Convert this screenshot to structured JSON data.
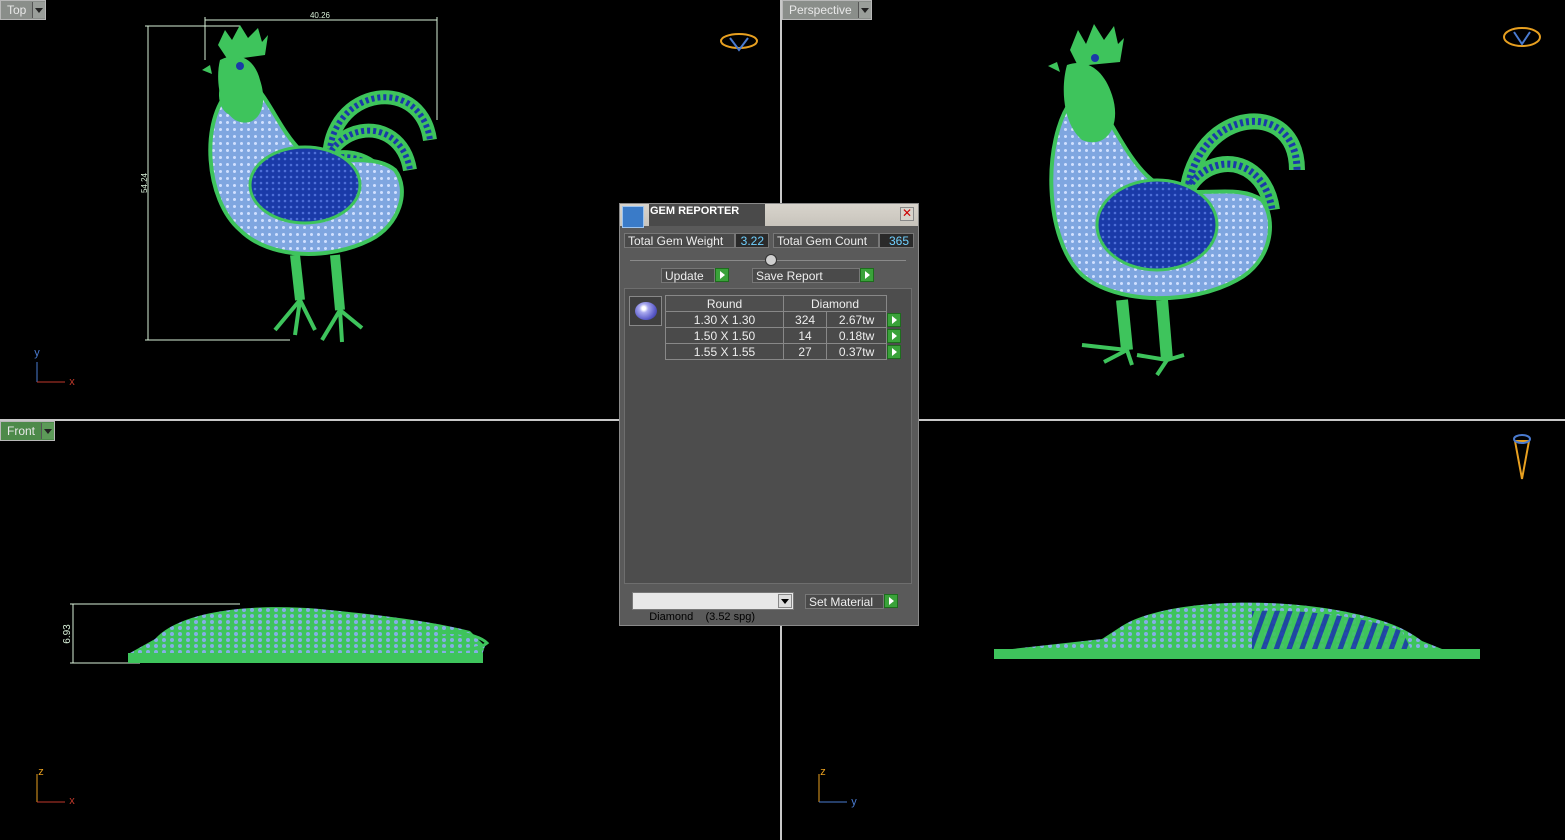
{
  "viewports": {
    "top": {
      "label": "Top",
      "dim_width": "40.26",
      "dim_height": "54.24",
      "axis_h": "x",
      "axis_v": "y"
    },
    "perspective": {
      "label": "Perspective"
    },
    "front": {
      "label": "Front",
      "dim_height": "6.93",
      "axis_h": "x",
      "axis_v": "z"
    },
    "right": {
      "axis_h": "y",
      "axis_v": "z"
    }
  },
  "gem_reporter": {
    "title": "GEM REPORTER",
    "close": "✕",
    "total_weight_label": "Total Gem Weight",
    "total_weight_value": "3.22",
    "total_count_label": "Total Gem Count",
    "total_count_value": "365",
    "update_label": "Update",
    "save_report_label": "Save Report",
    "table": {
      "shape": "Round",
      "material": "Diamond",
      "rows": [
        {
          "size": "1.30 X 1.30",
          "count": "324",
          "weight": "2.67tw"
        },
        {
          "size": "1.50 X 1.50",
          "count": "14",
          "weight": "0.18tw"
        },
        {
          "size": "1.55 X 1.55",
          "count": "27",
          "weight": "0.37tw"
        }
      ]
    },
    "material_select": "Diamond    (3.52 spg)",
    "set_material_label": "Set Material"
  },
  "colors": {
    "metal": "#4cd46a",
    "gem_light": "#86aee6",
    "gem_dark": "#1a3aa8",
    "dimension": "#d8f0d8",
    "axis_x": "#c0392b",
    "axis_y": "#4a7bd0",
    "gumball": "#e8a020"
  }
}
